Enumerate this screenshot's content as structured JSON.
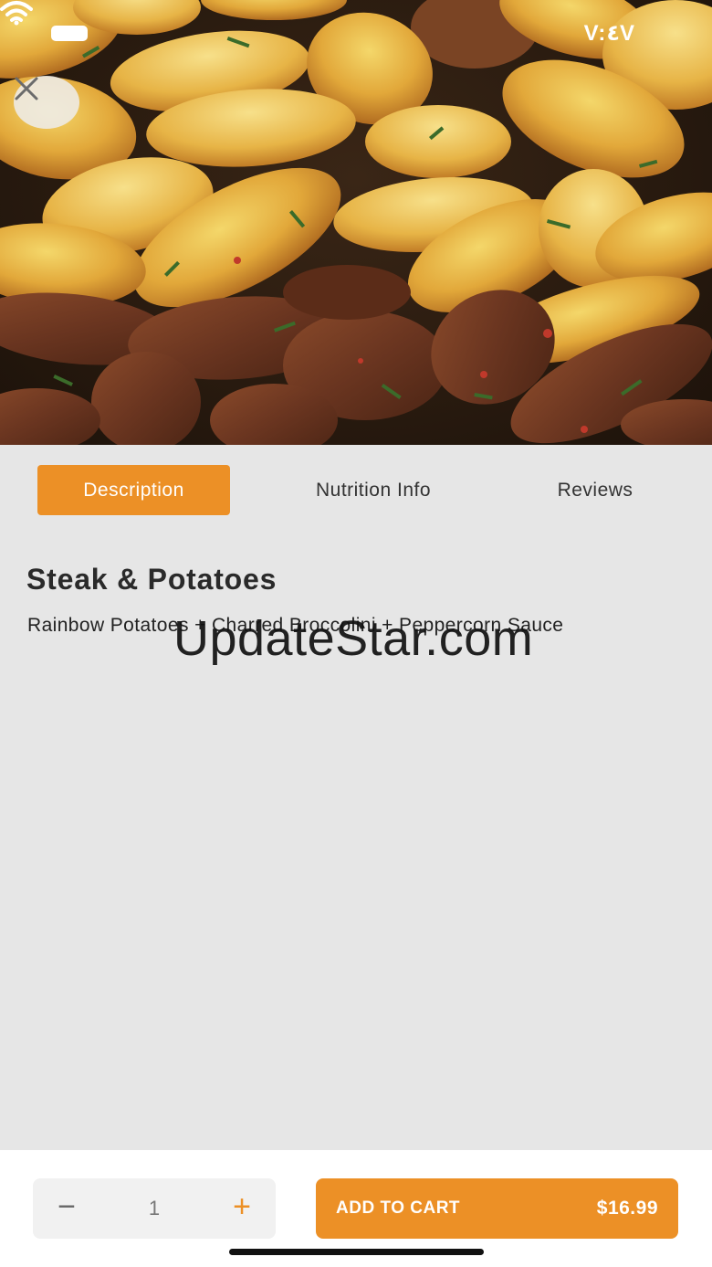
{
  "status_bar": {
    "time": "V:٤V"
  },
  "hero": {
    "image": "steak-and-potatoes-photo"
  },
  "tabs": [
    {
      "label": "Description",
      "active": true
    },
    {
      "label": "Nutrition Info",
      "active": false
    },
    {
      "label": "Reviews",
      "active": false
    }
  ],
  "dish": {
    "title": "Steak & Potatoes",
    "subtitle": "Rainbow Potatoes + Charred Broccolini + Peppercorn Sauce"
  },
  "watermark": "UpdateStar.com",
  "cart": {
    "quantity": "1",
    "minus_symbol": "−",
    "plus_symbol": "+",
    "add_label": "ADD TO CART",
    "price": "$16.99"
  },
  "colors": {
    "accent": "#ec9026",
    "background": "#e6e6e6"
  }
}
